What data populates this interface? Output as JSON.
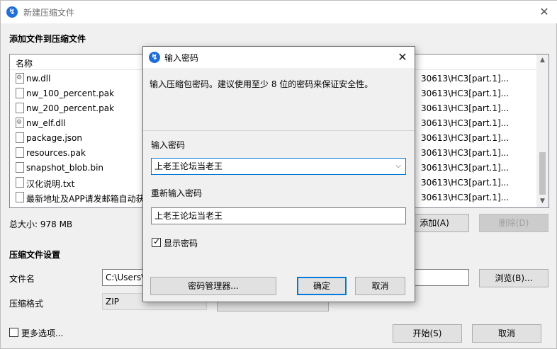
{
  "window": {
    "title": "新建压缩文件",
    "close_glyph": "✕",
    "add_files_title": "添加文件到压缩文件",
    "list_header": "名称",
    "files": [
      {
        "name": "nw.dll",
        "path": "30613\\HC3[part.1]...",
        "icon": "gear"
      },
      {
        "name": "nw_100_percent.pak",
        "path": "30613\\HC3[part.1]...",
        "icon": "file"
      },
      {
        "name": "nw_200_percent.pak",
        "path": "30613\\HC3[part.1]...",
        "icon": "file"
      },
      {
        "name": "nw_elf.dll",
        "path": "30613\\HC3[part.1]...",
        "icon": "gear"
      },
      {
        "name": "package.json",
        "path": "30613\\HC3[part.1]...",
        "icon": "file"
      },
      {
        "name": "resources.pak",
        "path": "30613\\HC3[part.1]...",
        "icon": "file"
      },
      {
        "name": "snapshot_blob.bin",
        "path": "30613\\HC3[part.1]...",
        "icon": "file"
      },
      {
        "name": "汉化说明.txt",
        "path": "30613\\HC3[part.1]...",
        "icon": "file"
      },
      {
        "name": "最新地址及APP请发邮箱自动获",
        "path": "30613\\HC3[part.1]...",
        "icon": "file"
      }
    ],
    "total_size": "总大小: 978 MB",
    "add_button": "添加(A)",
    "delete_button": "删除(D)",
    "settings_title": "压缩文件设置",
    "filename_label": "文件名",
    "filename_value": "C:\\Users\\",
    "browse_button": "浏览(B)...",
    "format_label": "压缩格式",
    "format_value": "ZIP",
    "more_options_label": "更多选项...",
    "start_button": "开始(S)",
    "cancel_button": "取消"
  },
  "dialog": {
    "title": "输入密码",
    "close_glyph": "✕",
    "description": "输入压缩包密码。建议使用至少 8 位的密码来保证安全性。",
    "password_label": "输入密码",
    "password_value": "上老王论坛当老王",
    "confirm_label": "重新输入密码",
    "confirm_value": "上老王论坛当老王",
    "show_password_label": "显示密码",
    "show_password_checked": true,
    "manager_button": "密码管理器...",
    "ok_button": "确定",
    "cancel_button": "取消"
  },
  "colors": {
    "accent": "#0078d7",
    "app_icon": "#1d6fe0"
  }
}
